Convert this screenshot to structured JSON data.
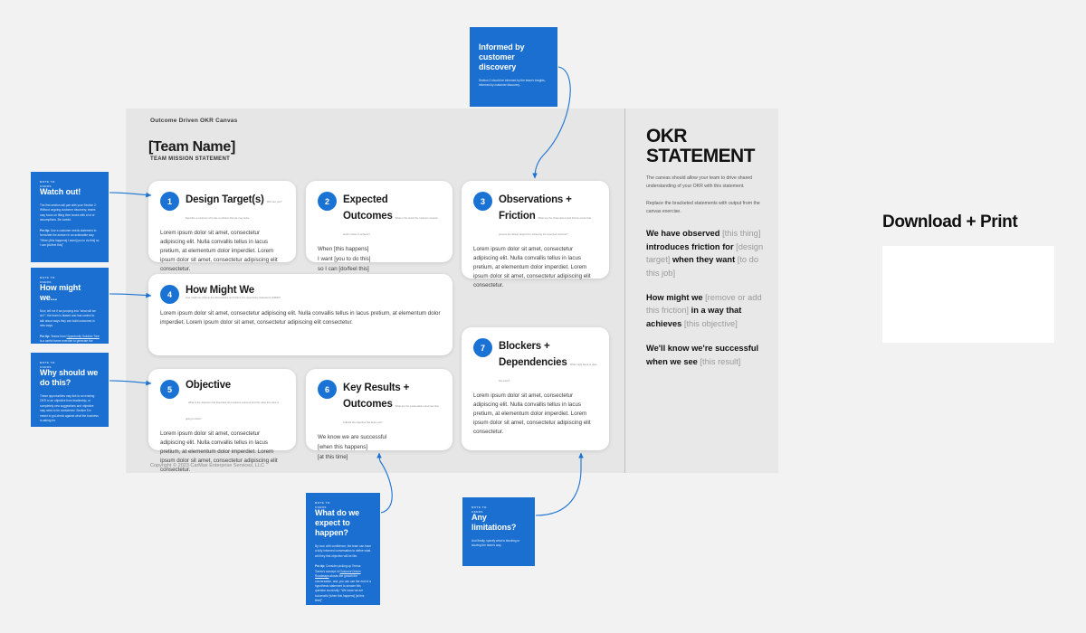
{
  "canvas": {
    "label": "Outcome Driven OKR Canvas",
    "team_name": "[Team Name]",
    "team_mission": "TEAM MISSION STATEMENT",
    "copyright": "Copyright © 2023 CarMax Enterprise Services, LLC"
  },
  "lorem": "Lorem ipsum dolor sit amet, consectetur adipiscing elit. Nulla convallis tellus in lacus pretium, at elementum dolor imperdiet. Lorem ipsum dolor sit amet, consectetur adipiscing elit consectetur.",
  "cards": [
    {
      "number": "1",
      "title": "Design Target(s)",
      "subtitle": "Who are you? Describe a customer who has a problem that we may solve.",
      "body": "Lorem ipsum dolor sit amet, consectetur adipiscing elit. Nulla convallis tellus in lacus pretium, at elementum dolor imperdiet. Lorem ipsum dolor sit amet, consectetur adipiscing elit consectetur."
    },
    {
      "number": "2",
      "title": "Expected Outcomes",
      "subtitle": "What is the result the customer expects and/or wants to achieve?",
      "body": "When [this happens]\nI want [you to do this]\nso I can [do/feel this]"
    },
    {
      "number": "3",
      "title": "Observations + Friction",
      "subtitle": "What are the observations and friction points that prevent the design target from achieving the expected outcome?",
      "body": "Lorem ipsum dolor sit amet, consectetur adipiscing elit. Nulla convallis tellus in lacus pretium, at elementum dolor imperdiet. Lorem ipsum dolor sit amet, consectetur adipiscing elit consectetur."
    },
    {
      "number": "4",
      "title": "How Might We",
      "subtitle": "How might we reframe the observations and friction into opportunity statements (HMW)?",
      "body": "Lorem ipsum dolor sit amet, consectetur adipiscing elit. Nulla convallis tellus in lacus pretium, at elementum dolor imperdiet. Lorem ipsum dolor sit amet, consectetur adipiscing elit consectetur."
    },
    {
      "number": "5",
      "title": "Objective",
      "subtitle": "What is the objective that describes the business outcome and the value this work is going to drive?",
      "body": "Lorem ipsum dolor sit amet, consectetur adipiscing elit. Nulla convallis tellus in lacus pretium, at elementum dolor imperdiet. Lorem ipsum dolor sit amet, consectetur adipiscing elit consectetur."
    },
    {
      "number": "6",
      "title": "Key Results + Outcomes",
      "subtitle": "What are the measurable outcomes that indicate the objective has been met?",
      "body": "We know we are successful\n[when this happens]\n[at this time]"
    },
    {
      "number": "7",
      "title": "Blockers + Dependencies",
      "subtitle": "What might block or slow this work?",
      "body": "Lorem ipsum dolor sit amet, consectetur adipiscing elit. Nulla convallis tellus in lacus pretium, at elementum dolor imperdiet. Lorem ipsum dolor sit amet, consectetur adipiscing elit consectetur."
    }
  ],
  "okr": {
    "title_line1": "OKR",
    "title_line2": "STATEMENT",
    "note1": "The canvas should allow your team to drive shared understanding of your OKR with this statement.",
    "note2": "Replace the bracketed statements with output from the canvas exercise.",
    "statement": [
      {
        "strong": "We have observed ",
        "plain": "[this thing] "
      },
      {
        "strong": "introduces friction for ",
        "plain": "[design target] "
      },
      {
        "strong": "when they want ",
        "plain": "[to do this job]"
      }
    ],
    "statement2": [
      {
        "strong": "How might we ",
        "plain": "[remove or add this friction] "
      },
      {
        "strong": "in a way that achieves ",
        "plain": "[this objective]"
      }
    ],
    "statement3": [
      {
        "strong": "We'll know we're successful when we see ",
        "plain": "[this result]"
      }
    ]
  },
  "notes": [
    {
      "id": "watch-out",
      "kicker": "NOTE TO",
      "kicker2": "USERS",
      "title": "Watch out!",
      "body": "The first section will pair with your Section 2. Without ongoing customer discovery, teams may focus on filling time boxes with a lot of assumptions. Be careful.",
      "body2_lead": "Pro tip:",
      "body2": " Use a customer needs statement to formulate the answer in an actionable way. \"When [this happens] I want [you to do this] so I can [do/feel this]\""
    },
    {
      "id": "how-might-we",
      "kicker": "NOTE TO",
      "kicker2": "USERS",
      "title": "How might we...",
      "body": "Now, tell me if we jumping into \"what will we do?\", the team is biased and has control to talk about ways they can build outcomes in new ways.",
      "body2_lead": "Pro tip:",
      "body2": " Teams from ",
      "body2_link": "Opportunity Solution Tree",
      "body2_end": " is a useful frame exercise to generate the most actionable context for this section."
    },
    {
      "id": "why-should-we",
      "kicker": "NOTE TO",
      "kicker2": "USERS",
      "title": "Why should we do this?",
      "body": "These opportunities may link to an existing OKR or an objective from leadership, or completely new suggestions and objective may need to be considered. Section 5 is meant to gut-check against what the business is asking for."
    },
    {
      "id": "informed-by-customer-discovery",
      "title": "Informed by customer discovery",
      "body": "Section 2 should be informed by the team's insights, informed by customer discovery."
    },
    {
      "id": "what-do-we-expect",
      "kicker": "NOTE TO",
      "kicker2": "USERS",
      "title": "What do we expect to happen?",
      "body": "By now, with confidence, the team can have a fully informed conversation to define what will they first objective will be like.",
      "body2_lead": "Pro tip:",
      "body2": " Consider picking up Teresa Torres's concept of ",
      "body2_link": "Outcome Driven Roadmaps",
      "body2_end": " abouts the growth the conversation, and, you can use the end of a hypothesis statement to answer this question succinctly: \"We know we are successful [when this happens] [at this time]\""
    },
    {
      "id": "any-limitations",
      "kicker": "NOTE TO",
      "kicker2": "USERS",
      "title": "Any limitations?",
      "body": "And finally, specify what is blocking or slowing the team's way."
    }
  ],
  "download": {
    "title": "Download + Print"
  },
  "colors": {
    "accent_blue": "#1a73d4",
    "sticky_blue": "#1a6fd0",
    "page_bg": "#f2f2f2",
    "canvas_bg": "#e6e6e6"
  }
}
